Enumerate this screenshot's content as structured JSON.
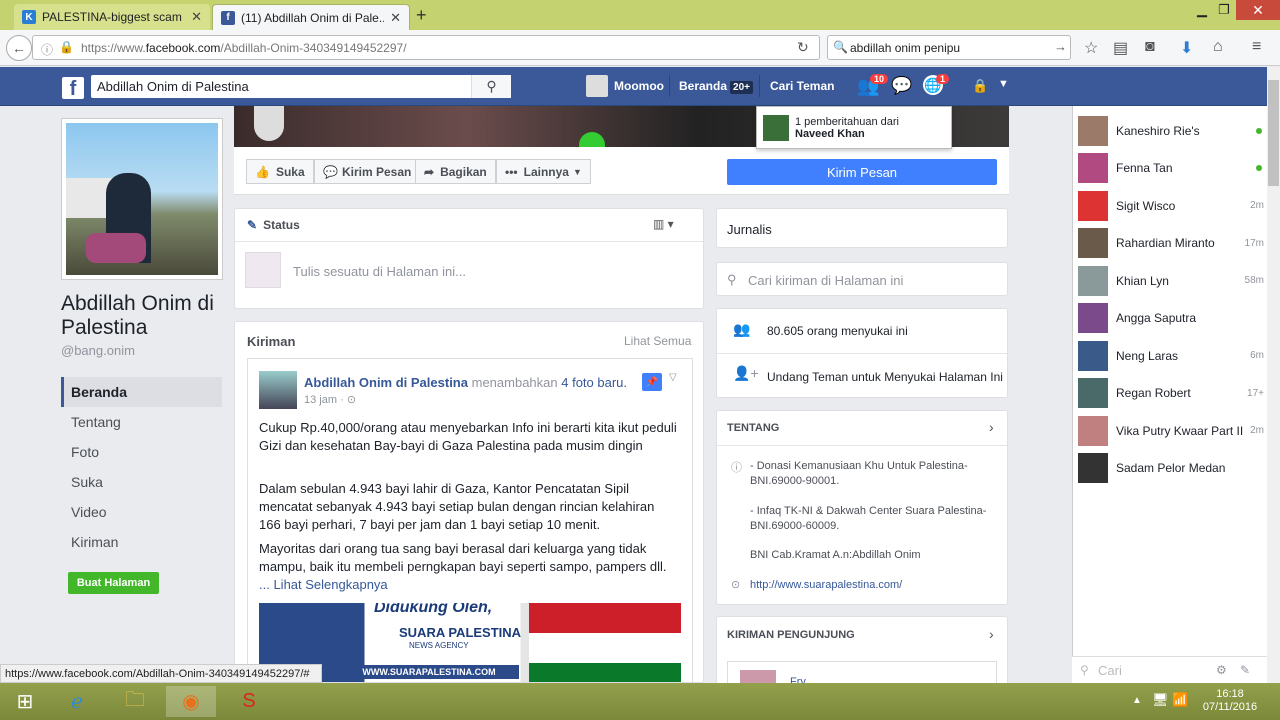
{
  "browser": {
    "tabs": [
      {
        "title": "PALESTINA-biggest scam ...",
        "favicon": "K",
        "color": "#2a7fd4"
      },
      {
        "title": "(11) Abdillah Onim di Pale...",
        "favicon": "f",
        "color": "#3b5998"
      }
    ],
    "url_prefix": "https://www.",
    "url_domain": "facebook.com",
    "url_path": "/Abdillah-Onim-340349149452297/",
    "search_value": "abdillah onim penipu"
  },
  "fb": {
    "search_value": "Abdillah Onim di Palestina",
    "nav": {
      "profile": "Moomoo",
      "home": "Beranda",
      "home_count": "20+",
      "find": "Cari Teman"
    },
    "badges": {
      "friends": "10",
      "globe": "1"
    },
    "notif_text": "1 pemberitahuan dari",
    "notif_name": "Naveed Khan"
  },
  "page": {
    "name": "Abdillah Onim di Palestina",
    "username": "@bang.onim",
    "nav": [
      "Beranda",
      "Tentang",
      "Foto",
      "Suka",
      "Video",
      "Kiriman"
    ],
    "create_button": "Buat Halaman",
    "actions": {
      "like": "Suka",
      "message": "Kirim Pesan",
      "share": "Bagikan",
      "more": "Lainnya"
    },
    "send_message": "Kirim Pesan"
  },
  "status": {
    "label": "Status",
    "placeholder": "Tulis sesuatu di Halaman ini..."
  },
  "posts": {
    "header": "Kiriman",
    "see_all": "Lihat Semua",
    "author": "Abdillah Onim di Palestina",
    "action": "menambahkan",
    "photos": "4 foto baru.",
    "time": "13 jam",
    "p1": "Cukup Rp.40,000/orang atau menyebarkan Info ini berarti kita ikut peduli Gizi dan kesehatan Bay-bayi di Gaza Palestina pada musim dingin",
    "p2": "Dalam sebulan 4.943 bayi lahir di Gaza, Kantor Pencatatan Sipil mencatat sebanyak 4.943 bayi setiap bulan dengan rincian kelahiran 166 bayi perhari, 7 bayi per jam dan 1 bayi setiap 10 menit.",
    "p3": "Mayoritas dari orang tua sang bayi berasal dari keluarga yang tidak mampu, baik itu membeli perngkapan bayi seperti sampo, pampers dll.",
    "more": "... Lihat Selengkapnya",
    "img_line1": "Didukung Oleh,",
    "img_line2": "SUARA PALESTINA",
    "img_line3": "NEWS AGENCY",
    "img_url": "WWW.SUARAPALESTINA.COM"
  },
  "right": {
    "jurnalis": "Jurnalis",
    "search_placeholder": "Cari kiriman di Halaman ini",
    "likes": "80.605 orang menyukai ini",
    "invite": "Undang Teman untuk Menyukai Halaman Ini",
    "about_header": "TENTANG",
    "about1": "- Donasi Kemanusiaan Khu Untuk Palestina-BNI.69000-90001.",
    "about2": "- Infaq TK-NI & Dakwah Center Suara Palestina-BNI.69000-60009.",
    "about3": "BNI Cab.Kramat A.n:Abdillah Onim",
    "website": "http://www.suarapalestina.com/",
    "visitor_header": "KIRIMAN PENGUNJUNG",
    "visitor_name": "Fry"
  },
  "chat": {
    "contacts": [
      {
        "name": "Kaneshiro Rie's",
        "time": "",
        "online": true,
        "color": "#9c7a6a"
      },
      {
        "name": "Fenna Tan",
        "time": "",
        "online": true,
        "color": "#b04a80"
      },
      {
        "name": "Sigit Wisco",
        "time": "2m",
        "online": false,
        "color": "#d33"
      },
      {
        "name": "Rahardian Miranto",
        "time": "17m",
        "online": false,
        "color": "#6a5a4a"
      },
      {
        "name": "Khian Lyn",
        "time": "58m",
        "online": false,
        "color": "#8a9a9a"
      },
      {
        "name": "Angga Saputra",
        "time": "",
        "online": false,
        "color": "#7a4a8a"
      },
      {
        "name": "Neng Laras",
        "time": "6m",
        "online": false,
        "color": "#3a5a8a"
      },
      {
        "name": "Regan Robert",
        "time": "17+",
        "online": false,
        "color": "#4a6a6a"
      },
      {
        "name": "Vika Putry Kwaar Part II",
        "time": "2m",
        "online": false,
        "color": "#c08080"
      },
      {
        "name": "Sadam Pelor Medan",
        "time": "",
        "online": false,
        "color": "#333"
      }
    ],
    "search_placeholder": "Cari"
  },
  "statusbar_url": "https://www.facebook.com/Abdillah-Onim-340349149452297/#",
  "taskbar": {
    "time": "16:18",
    "date": "07/11/2016"
  }
}
